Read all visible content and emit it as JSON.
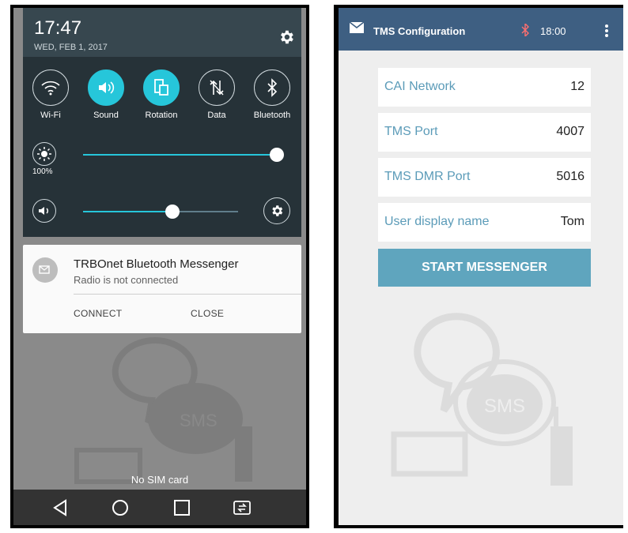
{
  "left_phone": {
    "status": {
      "time": "17:47",
      "date": "WED, FEB 1, 2017"
    },
    "toggles": [
      {
        "label": "Wi-Fi",
        "icon": "wifi-icon",
        "on": false
      },
      {
        "label": "Sound",
        "icon": "volume-icon",
        "on": true
      },
      {
        "label": "Rotation",
        "icon": "rotation-icon",
        "on": true
      },
      {
        "label": "Data",
        "icon": "data-icon",
        "on": false
      },
      {
        "label": "Bluetooth",
        "icon": "bluetooth-icon",
        "on": false
      }
    ],
    "brightness": {
      "percent_label": "100%",
      "level": 1.0
    },
    "volume": {
      "level": 0.5
    },
    "notification": {
      "title": "TRBOnet Bluetooth Messenger",
      "text": "Radio is not connected",
      "actions": [
        "CONNECT",
        "CLOSE"
      ]
    },
    "sim_status": "No SIM card",
    "background_art_text": "SMS"
  },
  "right_phone": {
    "actionbar": {
      "title": "TMS Configuration",
      "time": "18:00"
    },
    "fields": [
      {
        "label": "CAI Network",
        "value": "12"
      },
      {
        "label": "TMS Port",
        "value": "4007"
      },
      {
        "label": "TMS DMR Port",
        "value": "5016"
      },
      {
        "label": "User display name",
        "value": "Tom"
      }
    ],
    "start_button": "START MESSENGER",
    "background_art_text": "SMS"
  },
  "colors": {
    "accent_teal": "#26c6da",
    "actionbar_blue": "#3e5f82",
    "field_label": "#5b9bb8",
    "start_button": "#5fa5be"
  }
}
